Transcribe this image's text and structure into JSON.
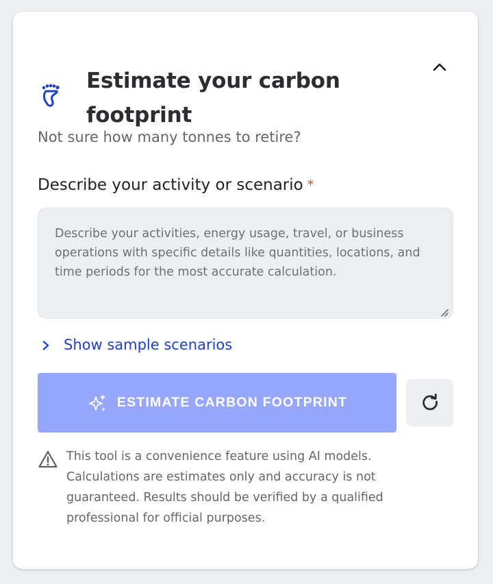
{
  "card": {
    "title": "Estimate your carbon footprint",
    "subtitle": "Not sure how many tonnes to retire?",
    "header_icon": "footprint-icon",
    "collapse_icon": "chevron-up-icon"
  },
  "form": {
    "activity_label": "Describe your activity or scenario",
    "required_marker": "*",
    "activity_value": "",
    "activity_placeholder": "Describe your activities, energy usage, travel, or business operations with specific details like quantities, locations, and time periods for the most accurate calculation."
  },
  "samples": {
    "label": "Show sample scenarios",
    "icon": "chevron-right-icon"
  },
  "actions": {
    "estimate_label": "ESTIMATE CARBON FOOTPRINT",
    "estimate_icon": "sparkle-icon",
    "reset_icon": "refresh-icon"
  },
  "disclaimer": {
    "icon": "warning-icon",
    "text": "This tool is a convenience feature using AI models. Calculations are estimates only and accuracy is not guaranteed. Results should be verified by a qualified professional for official purposes."
  },
  "colors": {
    "accent": "#1f3fc9",
    "button_disabled": "#97a7fd",
    "required": "#e34a2a",
    "page_bg": "#eceef2"
  }
}
